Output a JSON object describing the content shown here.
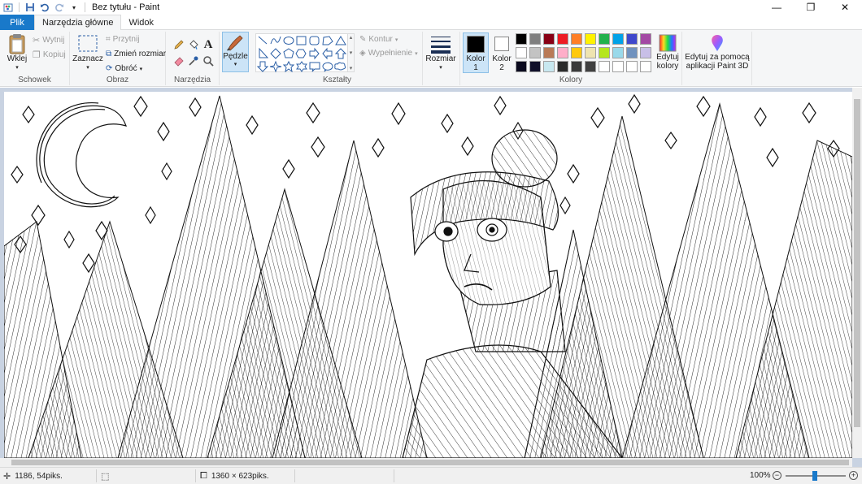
{
  "titlebar": {
    "title": "Bez tytułu - Paint",
    "minimize": "—",
    "maximize": "❐",
    "close": "✕"
  },
  "tabs": [
    {
      "label": "Plik"
    },
    {
      "label": "Narzędzia główne"
    },
    {
      "label": "Widok"
    }
  ],
  "ribbon": {
    "clipboard": {
      "group_label": "Schowek",
      "paste": "Wklej",
      "cut": "Wytnij",
      "copy": "Kopiuj"
    },
    "image": {
      "group_label": "Obraz",
      "select": "Zaznacz",
      "crop": "Przytnij",
      "resize": "Zmień rozmiar",
      "rotate": "Obróć"
    },
    "tools": {
      "group_label": "Narzędzia",
      "text_icon": "A"
    },
    "brushes": {
      "label": "Pędzle"
    },
    "shapes": {
      "group_label": "Kształty",
      "outline": "Kontur",
      "fill": "Wypełnienie"
    },
    "size": {
      "label": "Rozmiar"
    },
    "colors": {
      "group_label": "Kolory",
      "color1_label": "Kolor",
      "color1_num": "1",
      "color2_label": "Kolor",
      "color2_num": "2",
      "color1": "#000000",
      "color2": "#ffffff",
      "edit_label1": "Edytuj",
      "edit_label2": "kolory",
      "palette_row1": [
        "#000000",
        "#7f7f7f",
        "#880015",
        "#ed1c24",
        "#ff7f27",
        "#fff200",
        "#22b14c",
        "#00a2e8",
        "#3f48cc",
        "#a349a4"
      ],
      "palette_row2": [
        "#ffffff",
        "#c3c3c3",
        "#b97a57",
        "#ffaec9",
        "#ffc90e",
        "#efe4b0",
        "#b5e61d",
        "#99d9ea",
        "#7092be",
        "#c8bfe7"
      ],
      "palette_row3": [
        "#0a0a1e",
        "#10102a",
        "#c8e8f0",
        "#2b2b2b",
        "#3a3a3a",
        "#404040",
        "#ffffff",
        "#ffffff",
        "#ffffff",
        "#ffffff"
      ]
    },
    "paint3d": {
      "label1": "Edytuj za pomocą",
      "label2": "aplikacji Paint 3D"
    }
  },
  "status": {
    "cursor_pos": "1186, 54piks.",
    "canvas_size": "1360 × 623piks.",
    "zoom": "100%"
  }
}
